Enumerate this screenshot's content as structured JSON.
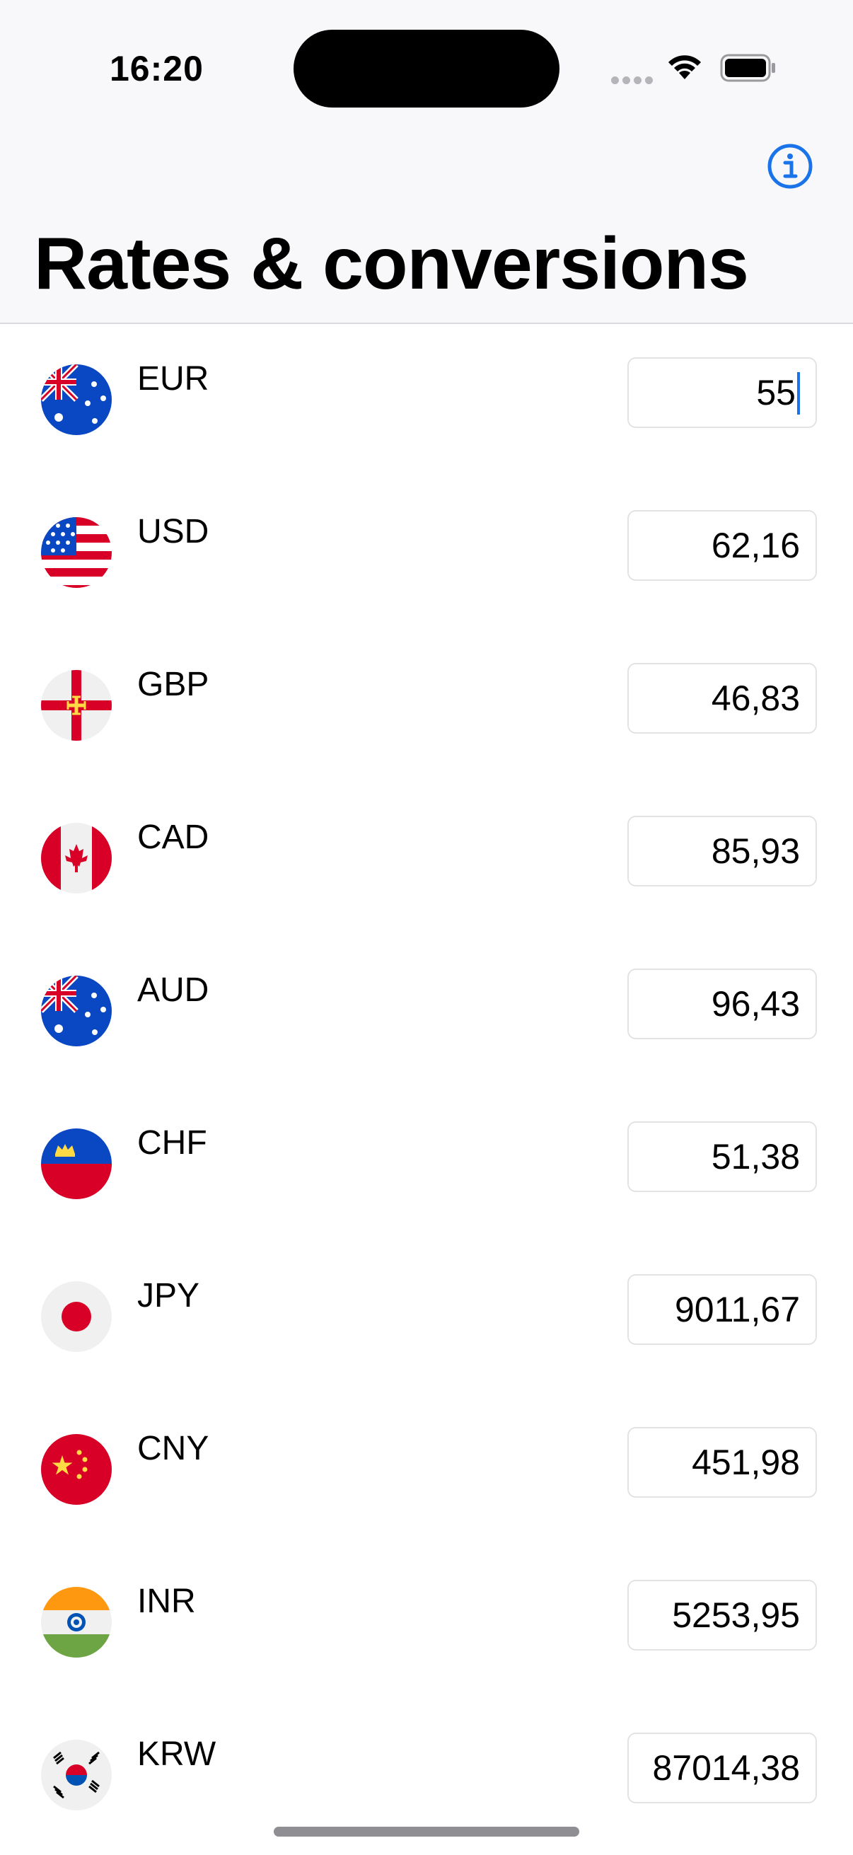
{
  "status_bar": {
    "time": "16:20"
  },
  "header": {
    "title": "Rates & conversions",
    "info_icon": "info-circle-icon"
  },
  "colors": {
    "accent": "#1a73e8"
  },
  "currencies": [
    {
      "code": "EUR",
      "value": "55",
      "flag": "australia-flag-icon",
      "active": true
    },
    {
      "code": "USD",
      "value": "62,16",
      "flag": "usa-flag-icon"
    },
    {
      "code": "GBP",
      "value": "46,83",
      "flag": "guernsey-flag-icon"
    },
    {
      "code": "CAD",
      "value": "85,93",
      "flag": "canada-flag-icon"
    },
    {
      "code": "AUD",
      "value": "96,43",
      "flag": "australia-flag-icon"
    },
    {
      "code": "CHF",
      "value": "51,38",
      "flag": "liechtenstein-flag-icon"
    },
    {
      "code": "JPY",
      "value": "9011,67",
      "flag": "japan-flag-icon"
    },
    {
      "code": "CNY",
      "value": "451,98",
      "flag": "china-flag-icon"
    },
    {
      "code": "INR",
      "value": "5253,95",
      "flag": "india-flag-icon"
    },
    {
      "code": "KRW",
      "value": "87014,38",
      "flag": "south-korea-flag-icon"
    }
  ]
}
